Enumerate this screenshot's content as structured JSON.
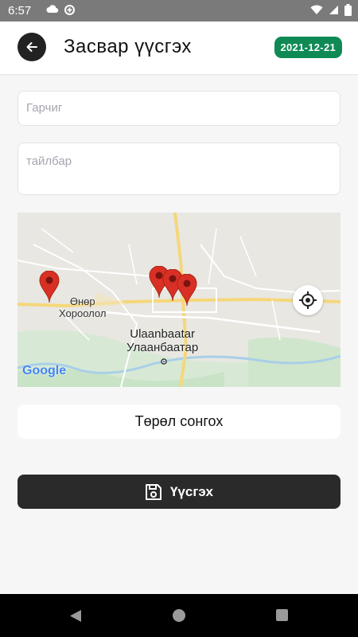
{
  "status_bar": {
    "time": "6:57",
    "icons": [
      "cloud-icon",
      "data-saver-icon",
      "wifi-icon",
      "signal-icon",
      "battery-icon"
    ]
  },
  "header": {
    "title": "Засвар үүсгэх",
    "date": "2021-12-21",
    "back_icon": "arrow-left-icon"
  },
  "form": {
    "title_placeholder": "Гарчиг",
    "description_placeholder": "тайлбар"
  },
  "map": {
    "labels": {
      "district_line1": "Өнөр",
      "district_line2": "Хороолол",
      "city_latin": "Ulaanbaatar",
      "city_cyrillic": "Улаанбаатар",
      "attribution": "Google"
    },
    "markers": 4,
    "locate_icon": "crosshair-icon"
  },
  "type_select": {
    "label": "Төрөл сонгох"
  },
  "save_button": {
    "label": "Үүсгэх",
    "icon": "save-icon"
  },
  "colors": {
    "accent": "#0f8a55",
    "dark": "#2a2a2a",
    "background": "#f6f6f6"
  }
}
